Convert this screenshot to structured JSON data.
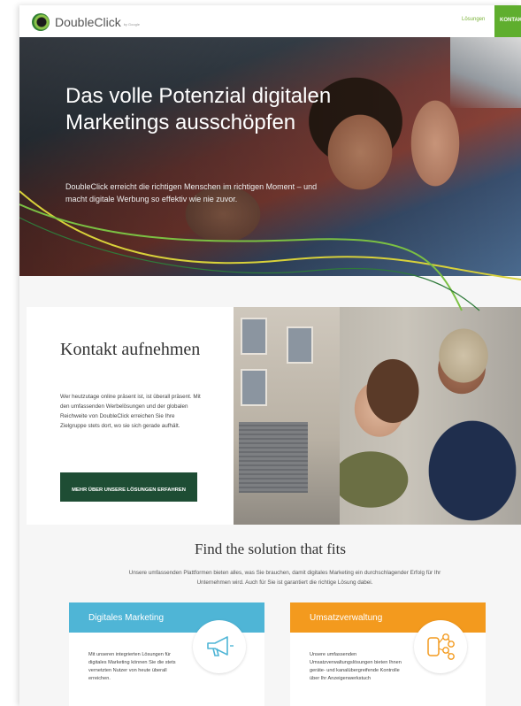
{
  "header": {
    "logo_text": "DoubleClick",
    "logo_sub": "by Google",
    "nav_link": "Lösungen",
    "nav_cta": "KONTAKT"
  },
  "hero": {
    "title": "Das volle Potenzial digitalen Marketings ausschöpfen",
    "text": "DoubleClick erreicht die richtigen Menschen im richtigen Moment – und macht digitale Werbung so effektiv wie nie zuvor."
  },
  "contact": {
    "title": "Kontakt aufnehmen",
    "text": "Wer heutzutage online präsent ist, ist überall präsent. Mit den umfassenden Werbelösungen und der globalen Reichweite von DoubleClick erreichen Sie Ihre Zielgruppe stets dort, wo sie sich gerade aufhält.",
    "button": "MEHR ÜBER UNSERE LÖSUNGEN ERFAHREN"
  },
  "solutions": {
    "title": "Find the solution that fits",
    "text": "Unsere umfassenden Plattformen bieten alles, was Sie brauchen, damit digitales Marketing ein durchschlagender Erfolg für Ihr Unternehmen wird. Auch für Sie ist garantiert die richtige Lösung dabei.",
    "cards": [
      {
        "title": "Digitales Marketing",
        "text": "Mit unseren integrierten Lösungen für digitales Marketing können Sie die stets vernetzten Nutzer von heute überall erreichen.",
        "icon": "megaphone-icon",
        "color": "#4fb5d6"
      },
      {
        "title": "Umsatzverwaltung",
        "text": "Unsere umfassenden Umsatzverwaltungslösungen bieten Ihnen geräte- und kanalübergreifende Kontrolle über Ihr Anzeigenwerkstuch",
        "icon": "network-icon",
        "color": "#f39a1e"
      }
    ]
  },
  "colors": {
    "brand_green": "#5fae2e",
    "dark_green": "#1e4d34",
    "line_yellow": "#d8d13a",
    "line_green": "#7bc043"
  }
}
